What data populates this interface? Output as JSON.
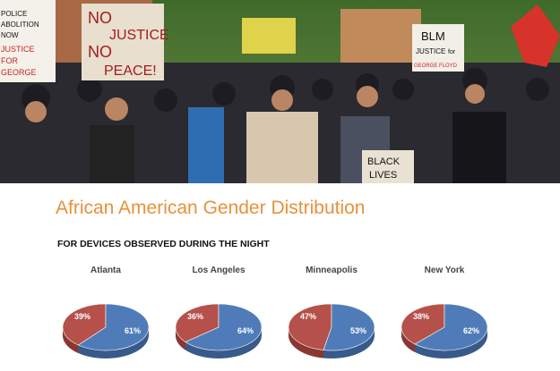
{
  "photo": {
    "signs": {
      "no_justice": [
        "NO",
        "JUSTICE",
        "NO",
        "PEACE!"
      ],
      "blm": [
        "BLM",
        "JUSTICE",
        "for",
        "GEORGE FLOYD"
      ],
      "police": [
        "POLICE",
        "ABOLITION",
        "NOW",
        "JUSTICE",
        "FOR",
        "GEORGE"
      ],
      "black_lives": [
        "BLACK",
        "LIVES"
      ]
    }
  },
  "title": "African American Gender Distribution",
  "subtitle": "FOR DEVICES OBSERVED DURING THE NIGHT",
  "colors": {
    "title": "#e8913a",
    "series_a": "#b5504a",
    "series_b": "#4f7cb9",
    "series_a_side": "#8a3732",
    "series_b_side": "#385a8b"
  },
  "chart_data": [
    {
      "type": "pie",
      "title": "Atlanta",
      "values": [
        39,
        61
      ],
      "labels": [
        "39%",
        "61%"
      ]
    },
    {
      "type": "pie",
      "title": "Los Angeles",
      "values": [
        36,
        64
      ],
      "labels": [
        "36%",
        "64%"
      ]
    },
    {
      "type": "pie",
      "title": "Minneapolis",
      "values": [
        47,
        53
      ],
      "labels": [
        "47%",
        "53%"
      ]
    },
    {
      "type": "pie",
      "title": "New York",
      "values": [
        38,
        62
      ],
      "labels": [
        "38%",
        "62%"
      ]
    }
  ]
}
